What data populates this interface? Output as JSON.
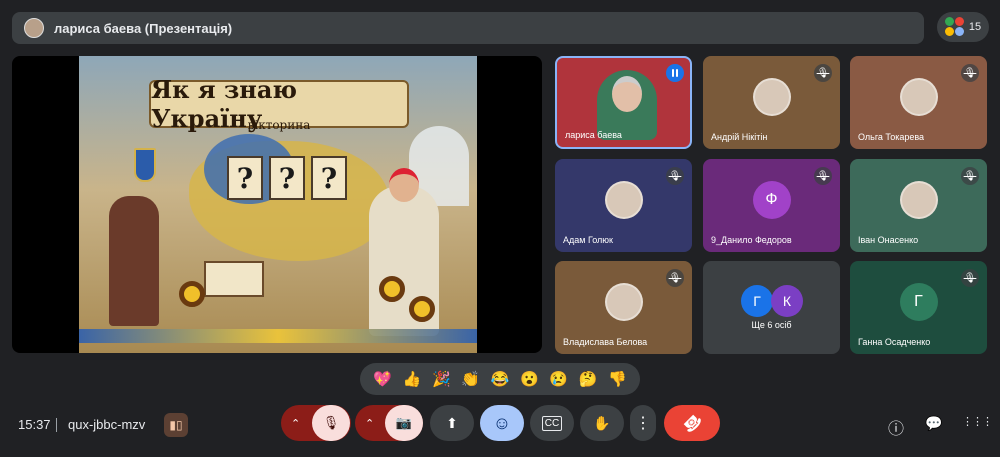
{
  "header": {
    "title": "лариса баева (Презентація)",
    "participants_count": "15"
  },
  "slide": {
    "title": "Як я знаю Україну",
    "subtitle": "вікторина",
    "marks": [
      "?",
      "?",
      "?"
    ]
  },
  "tiles": [
    {
      "name": "лариса баева",
      "type": "video",
      "bg": "#b0343c",
      "speaking": true
    },
    {
      "name": "Андрій Нікітін",
      "type": "photo",
      "bg": "#7a5a3a",
      "muted": true
    },
    {
      "name": "Ольга Токарева",
      "type": "photo",
      "bg": "#8a5a44",
      "muted": true
    },
    {
      "name": "Адам Голюк",
      "type": "photo",
      "bg": "#34386a",
      "muted": true
    },
    {
      "name": "9_Данило Федоров",
      "type": "letter",
      "letter": "Ф",
      "bg": "#6a2a7a",
      "avatar_bg": "#a142c8",
      "muted": true
    },
    {
      "name": "Іван Онасенко",
      "type": "photo",
      "bg": "#3d6a5a",
      "muted": true
    },
    {
      "name": "Владислава Белова",
      "type": "photo",
      "bg": "#7a5a3a",
      "muted": true
    },
    {
      "name": "Ще 6 осіб",
      "type": "group",
      "letters": [
        "Г",
        "К"
      ],
      "bg": "#3c4043"
    },
    {
      "name": "Ганна Осадченко",
      "type": "letter",
      "letter": "Г",
      "bg": "#1e4d3e",
      "avatar_bg": "#2e7d5e",
      "muted": true
    }
  ],
  "reactions": [
    "💖",
    "👍",
    "🎉",
    "👏",
    "😂",
    "😮",
    "😢",
    "🤔",
    "👎"
  ],
  "footer": {
    "time": "15:37",
    "meeting_code": "qux-jbbc-mzv"
  },
  "icons": {
    "mic_off": "🎙",
    "cam_off": "📷",
    "present": "⬆",
    "emoji": "☺",
    "captions": "CC",
    "hand": "✋",
    "more": "⋮",
    "end": "☎",
    "info": "ⓘ",
    "chat": "💬",
    "activities": "⋮⋮⋮"
  }
}
